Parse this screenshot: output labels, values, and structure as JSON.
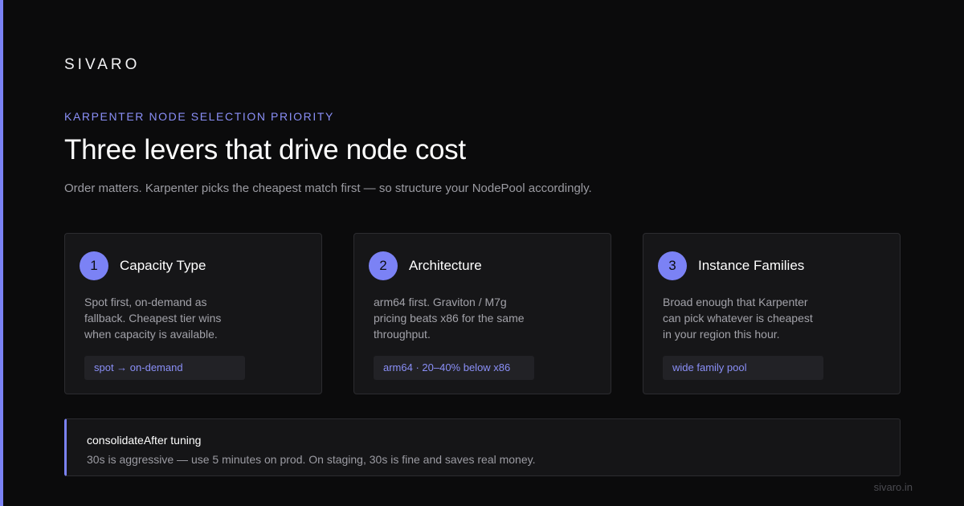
{
  "brand": "SIVARO",
  "eyebrow": "KARPENTER NODE SELECTION PRIORITY",
  "title": "Three levers that drive node cost",
  "subtitle": "Order matters. Karpenter picks the cheapest match first — so structure your NodePool accordingly.",
  "accent_color": "#7b82f5",
  "cards": [
    {
      "number": "1",
      "title": "Capacity Type",
      "body": "Spot first, on-demand as fallback. Cheapest tier wins when capacity is available.",
      "tag": "spot → on-demand"
    },
    {
      "number": "2",
      "title": "Architecture",
      "body": "arm64 first. Graviton / M7g pricing beats x86 for the same throughput.",
      "tag": "arm64 · 20–40% below x86"
    },
    {
      "number": "3",
      "title": "Instance Families",
      "body": "Broad enough that Karpenter can pick whatever is cheapest in your region this hour.",
      "tag": "wide family pool"
    }
  ],
  "note": {
    "title": "consolidateAfter tuning",
    "body": "30s is aggressive — use 5 minutes on prod. On staging, 30s is fine and saves real money."
  },
  "footer": "sivaro.in"
}
